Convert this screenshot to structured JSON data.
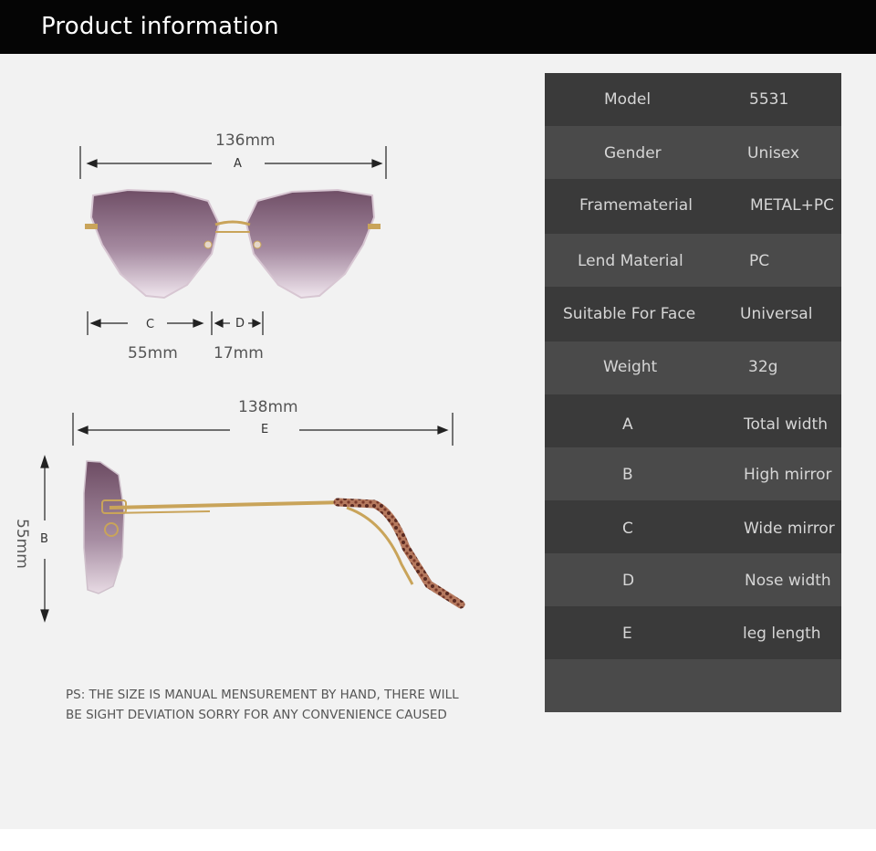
{
  "header": {
    "title": "Product information"
  },
  "front_view": {
    "dims": {
      "a_value": "136mm",
      "a_letter": "A",
      "c_value": "55mm",
      "c_letter": "C",
      "d_value": "17mm",
      "d_letter": "D"
    }
  },
  "side_view": {
    "dims": {
      "e_value": "138mm",
      "e_letter": "E",
      "b_value": "55mm",
      "b_letter": "B"
    }
  },
  "note": {
    "line1": "PS:  THE SIZE IS MANUAL MENSUREMENT BY HAND, THERE WILL",
    "line2": "BE SIGHT DEVIATION SORRY FOR ANY CONVENIENCE CAUSED"
  },
  "specs": [
    {
      "key": "Model",
      "value": "5531"
    },
    {
      "key": "Gender",
      "value": "Unisex"
    },
    {
      "key": "Framematerial",
      "value": "METAL+PC"
    },
    {
      "key": "Lend Material",
      "value": "PC"
    },
    {
      "key": "Suitable For Face",
      "value": "Universal"
    },
    {
      "key": "Weight",
      "value": "32g"
    },
    {
      "key": "A",
      "value": "Total width"
    },
    {
      "key": "B",
      "value": "High mirror"
    },
    {
      "key": "C",
      "value": "Wide mirror"
    },
    {
      "key": "D",
      "value": "Nose width"
    },
    {
      "key": "E",
      "value": "leg length"
    }
  ],
  "colors": {
    "header_bg": "#050505",
    "panel_bg": "#f2f2f2",
    "table_dark": "#3a3a3a",
    "table_light": "#4a4a4a",
    "lens": "#8a6a80",
    "frame_gold": "#c9a45a",
    "tortoise": "#8a4a3a"
  }
}
